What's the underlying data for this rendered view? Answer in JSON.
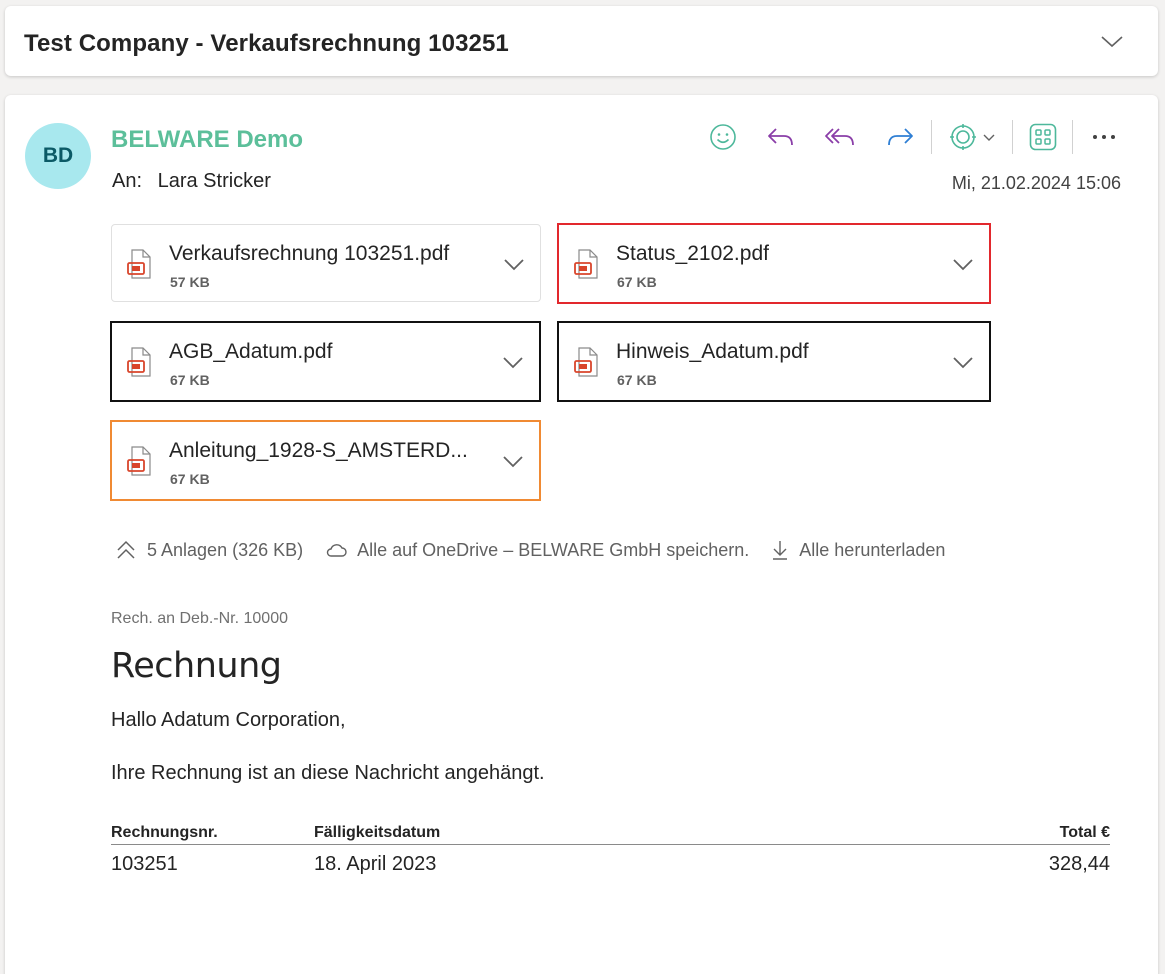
{
  "subject": {
    "title": "Test Company - Verkaufsrechnung 103251"
  },
  "message": {
    "avatar_initials": "BD",
    "sender_name": "BELWARE Demo",
    "recipient_label": "An:",
    "recipient_name": "Lara Stricker",
    "datetime": "Mi, 21.02.2024 15:06"
  },
  "toolbar": {
    "icons": [
      "emoji-icon",
      "reply-icon",
      "reply-all-icon",
      "forward-icon",
      "addin-icon",
      "apps-icon",
      "more-icon"
    ],
    "colors": {
      "emoji": "#4db89b",
      "reply": "#8a3ea8",
      "reply_all": "#8a3ea8",
      "forward": "#2f7fd4",
      "addin": "#4db89b",
      "apps": "#4db89b",
      "more": "#424242"
    }
  },
  "attachments": [
    {
      "name": "Verkaufsrechnung 103251.pdf",
      "size": "57 KB",
      "highlight": "none"
    },
    {
      "name": "Status_2102.pdf",
      "size": "67 KB",
      "highlight": "red"
    },
    {
      "name": "AGB_Adatum.pdf",
      "size": "67 KB",
      "highlight": "black"
    },
    {
      "name": "Hinweis_Adatum.pdf",
      "size": "67 KB",
      "highlight": "black"
    },
    {
      "name": "Anleitung_1928-S_AMSTERD...",
      "size": "67 KB",
      "highlight": "orange"
    }
  ],
  "attachment_summary": {
    "count": "5 Anlagen (326 KB)",
    "onedrive": "Alle auf OneDrive – BELWARE GmbH speichern.",
    "download": "Alle herunterladen"
  },
  "body": {
    "sender_line": "Rech. an Deb.-Nr. 10000",
    "heading": "Rechnung",
    "greeting": "Hallo Adatum Corporation,",
    "text": "Ihre Rechnung ist an diese Nachricht angehängt.",
    "table": {
      "headers": [
        "Rechnungsnr.",
        "Fälligkeitsdatum",
        "Total €"
      ],
      "rows": [
        [
          "103251",
          "18. April 2023",
          "328,44"
        ]
      ]
    }
  },
  "colors": {
    "pdf_icon": "#d9452b",
    "sender": "#5cbf9a",
    "avatar_bg": "#a8e8ee",
    "highlight_red": "#e2282d",
    "highlight_black": "#111111",
    "highlight_orange": "#f08a33"
  }
}
